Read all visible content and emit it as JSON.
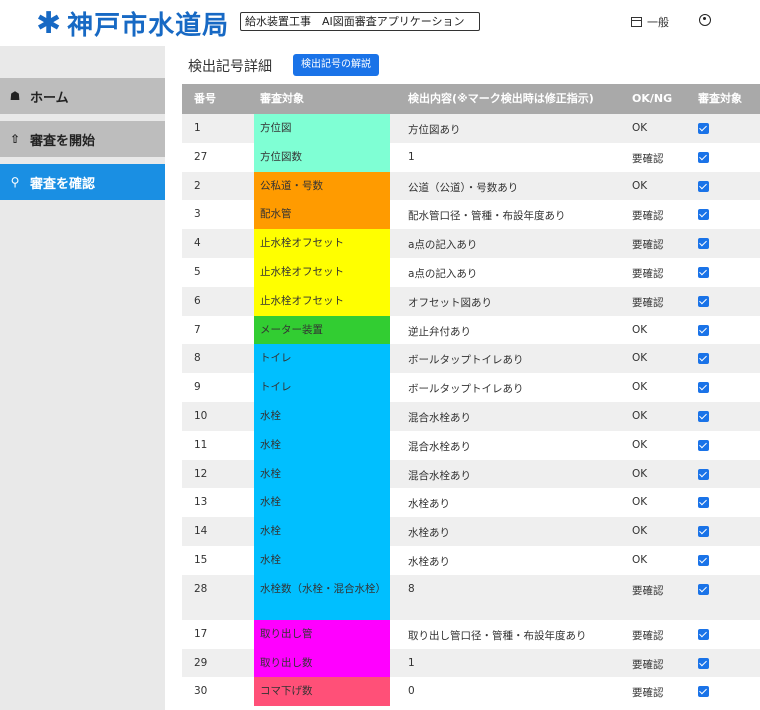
{
  "header": {
    "logo_mark": "✱",
    "logo_text": "神戸市水道局",
    "app_title": "給水装置工事　AI図面審査アプリケーション",
    "user_label": "一般"
  },
  "sidebar": {
    "items": [
      {
        "icon": "home-icon",
        "label": "ホーム",
        "active": false
      },
      {
        "icon": "upload-icon",
        "label": "審査を開始",
        "active": false
      },
      {
        "icon": "search-icon",
        "label": "審査を確認",
        "active": true
      }
    ]
  },
  "main": {
    "title": "検出記号詳細",
    "explain_button": "検出記号の解説",
    "columns": [
      "番号",
      "審査対象",
      "検出内容(※マーク検出時は修正指示)",
      "OK/NG",
      "審査対象"
    ],
    "rows": [
      {
        "no": "1",
        "target": "方位図",
        "color": "#7fffd4",
        "content": "方位図あり",
        "result": "OK",
        "checked": true
      },
      {
        "no": "27",
        "target": "方位図数",
        "color": "#7fffd4",
        "content": "1",
        "result": "要確認",
        "checked": true
      },
      {
        "no": "2",
        "target": "公私道・号数",
        "color": "#ff9b00",
        "content": "公道（公道）・号数あり",
        "result": "OK",
        "checked": true
      },
      {
        "no": "3",
        "target": "配水管",
        "color": "#ff9b00",
        "content": "配水管口径・管種・布設年度あり",
        "result": "要確認",
        "checked": true
      },
      {
        "no": "4",
        "target": "止水栓オフセット",
        "color": "#ffff00",
        "content": "a点の記入あり",
        "result": "要確認",
        "checked": true
      },
      {
        "no": "5",
        "target": "止水栓オフセット",
        "color": "#ffff00",
        "content": "a点の記入あり",
        "result": "要確認",
        "checked": true
      },
      {
        "no": "6",
        "target": "止水栓オフセット",
        "color": "#ffff00",
        "content": "オフセット図あり",
        "result": "要確認",
        "checked": true
      },
      {
        "no": "7",
        "target": "メーター装置",
        "color": "#32cd32",
        "content": "逆止弁付あり",
        "result": "OK",
        "checked": true
      },
      {
        "no": "8",
        "target": "トイレ",
        "color": "#00bfff",
        "content": "ボールタップトイレあり",
        "result": "OK",
        "checked": true
      },
      {
        "no": "9",
        "target": "トイレ",
        "color": "#00bfff",
        "content": "ボールタップトイレあり",
        "result": "OK",
        "checked": true
      },
      {
        "no": "10",
        "target": "水栓",
        "color": "#00bfff",
        "content": "混合水栓あり",
        "result": "OK",
        "checked": true
      },
      {
        "no": "11",
        "target": "水栓",
        "color": "#00bfff",
        "content": "混合水栓あり",
        "result": "OK",
        "checked": true
      },
      {
        "no": "12",
        "target": "水栓",
        "color": "#00bfff",
        "content": "混合水栓あり",
        "result": "OK",
        "checked": true
      },
      {
        "no": "13",
        "target": "水栓",
        "color": "#00bfff",
        "content": "水栓あり",
        "result": "OK",
        "checked": true
      },
      {
        "no": "14",
        "target": "水栓",
        "color": "#00bfff",
        "content": "水栓あり",
        "result": "OK",
        "checked": true
      },
      {
        "no": "15",
        "target": "水栓",
        "color": "#00bfff",
        "content": "水栓あり",
        "result": "OK",
        "checked": true
      },
      {
        "no": "28",
        "target": "水栓数（水栓・混合水栓）",
        "color": "#00bfff",
        "content": "8",
        "result": "要確認",
        "checked": true,
        "tall": true
      },
      {
        "no": "17",
        "target": "取り出し管",
        "color": "#ff00ff",
        "content": "取り出し管口径・管種・布設年度あり",
        "result": "要確認",
        "checked": true
      },
      {
        "no": "29",
        "target": "取り出し数",
        "color": "#ff00ff",
        "content": "1",
        "result": "要確認",
        "checked": true
      },
      {
        "no": "30",
        "target": "コマ下げ数",
        "color": "#ff5078",
        "content": "0",
        "result": "要確認",
        "checked": true
      }
    ]
  }
}
